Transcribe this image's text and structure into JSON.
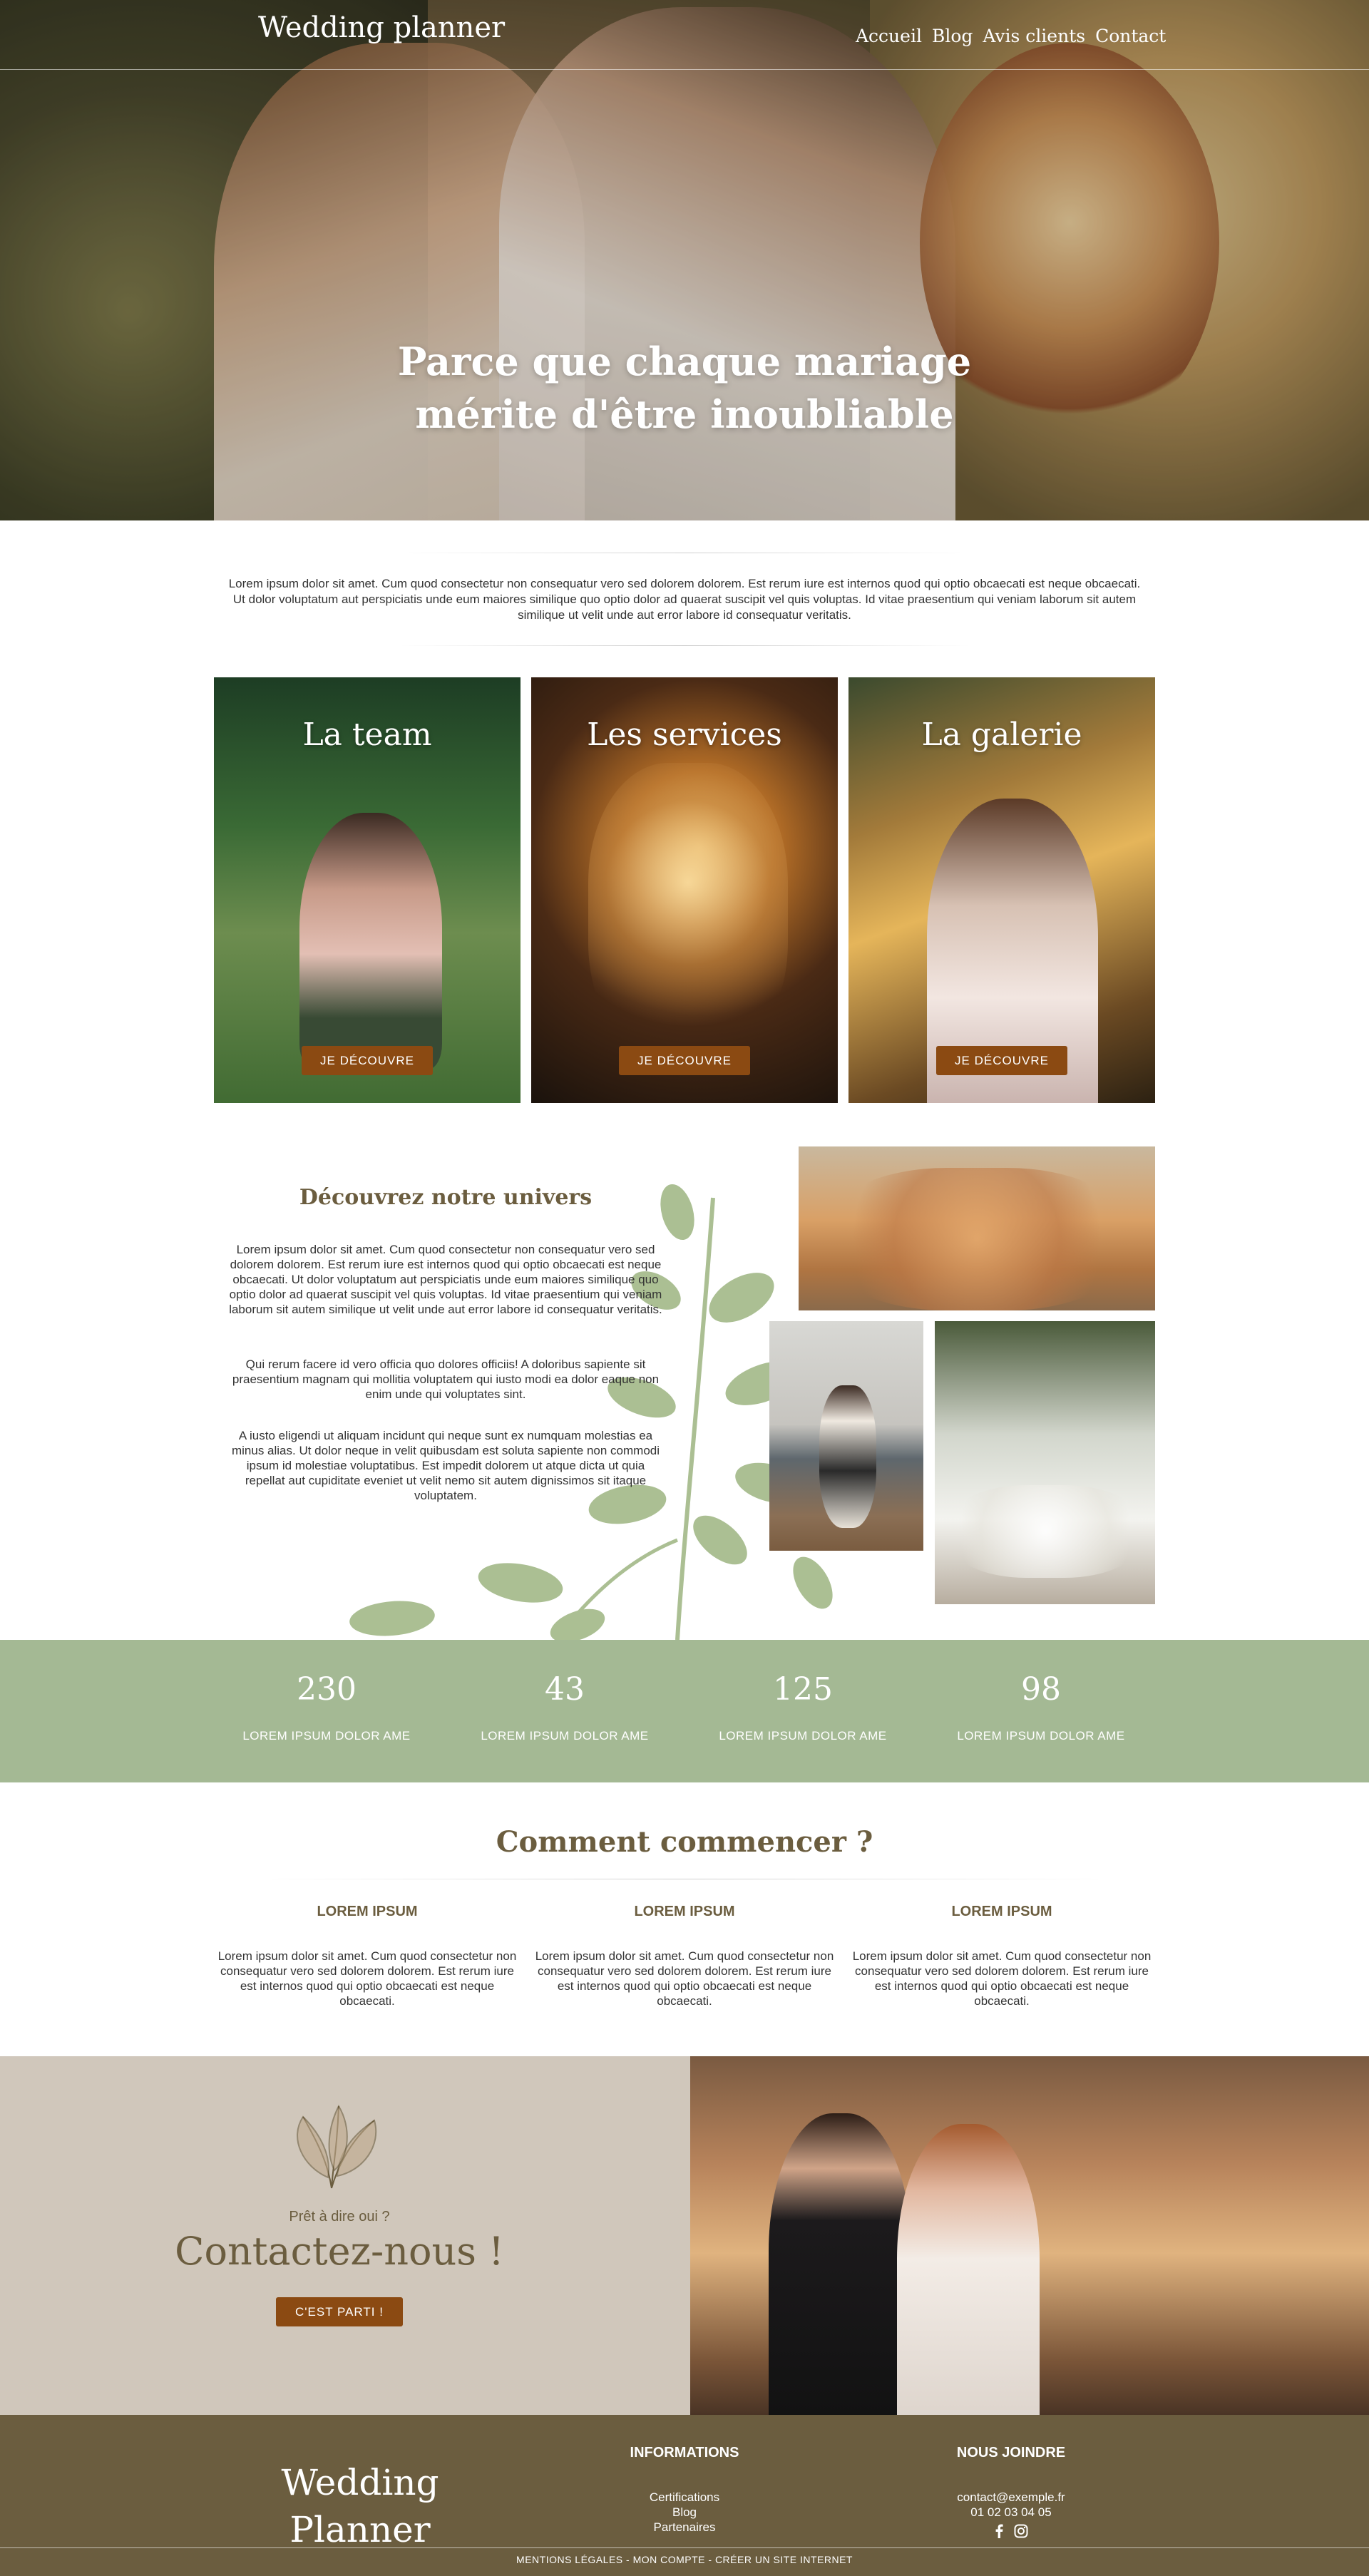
{
  "header": {
    "logo": "Wedding planner",
    "nav": [
      "Accueil",
      "Blog",
      "Avis clients",
      "Contact"
    ]
  },
  "hero": {
    "title": "Parce que chaque mariage mérite d'être inoubliable"
  },
  "intro": {
    "text": "Lorem ipsum dolor sit amet. Cum quod consectetur non consequatur vero sed dolorem dolorem. Est rerum iure est internos quod qui optio obcaecati est neque obcaecati. Ut dolor voluptatum aut perspiciatis unde eum maiores similique quo optio dolor ad quaerat suscipit vel quis voluptas. Id vitae praesentium qui veniam laborum sit autem similique ut velit unde aut error labore id consequatur veritatis."
  },
  "cards": [
    {
      "title": "La team",
      "button": "JE DÉCOUVRE"
    },
    {
      "title": "Les services",
      "button": "JE DÉCOUVRE"
    },
    {
      "title": "La galerie",
      "button": "JE DÉCOUVRE"
    }
  ],
  "univers": {
    "title": "Découvrez notre univers",
    "paragraphs": [
      "Lorem ipsum dolor sit amet. Cum quod consectetur non consequatur vero sed dolorem dolorem. Est rerum iure est internos quod qui optio obcaecati est neque obcaecati. Ut dolor voluptatum aut perspiciatis unde eum maiores similique quo optio dolor ad quaerat suscipit vel quis voluptas. Id vitae praesentium qui veniam laborum sit autem similique ut velit unde aut error labore id consequatur veritatis.",
      "Qui rerum facere id vero officia quo dolores officiis! A doloribus sapiente sit praesentium magnam qui mollitia voluptatem qui iusto modi ea dolor eaque non enim unde qui voluptates sint.",
      "A iusto eligendi ut aliquam incidunt qui neque sunt ex numquam molestias ea minus alias. Ut dolor neque in velit quibusdam est soluta sapiente non commodi ipsum id molestiae voluptatibus. Est impedit dolorem ut atque dicta ut quia repellat aut cupiditate eveniet ut velit nemo sit autem dignissimos sit itaque voluptatem."
    ]
  },
  "stats": [
    {
      "number": "230",
      "label": "LOREM IPSUM DOLOR AME"
    },
    {
      "number": "43",
      "label": "LOREM IPSUM DOLOR AME"
    },
    {
      "number": "125",
      "label": "LOREM IPSUM DOLOR AME"
    },
    {
      "number": "98",
      "label": "LOREM IPSUM DOLOR AME"
    }
  ],
  "start": {
    "title": "Comment commencer ?",
    "columns": [
      {
        "heading": "LOREM IPSUM",
        "text": "Lorem ipsum dolor sit amet. Cum quod consectetur non consequatur vero sed dolorem dolorem. Est rerum iure est internos quod qui optio obcaecati est neque obcaecati."
      },
      {
        "heading": "LOREM IPSUM",
        "text": "Lorem ipsum dolor sit amet. Cum quod consectetur non consequatur vero sed dolorem dolorem. Est rerum iure est internos quod qui optio obcaecati est neque obcaecati."
      },
      {
        "heading": "LOREM IPSUM",
        "text": "Lorem ipsum dolor sit amet. Cum quod consectetur non consequatur vero sed dolorem dolorem. Est rerum iure est internos quod qui optio obcaecati est neque obcaecati."
      }
    ]
  },
  "contact": {
    "small": "Prêt à dire oui ?",
    "title": "Contactez-nous !",
    "button": "C'EST PARTI !"
  },
  "footer": {
    "logo_line1": "Wedding",
    "logo_line2": "Planner",
    "info_title": "INFORMATIONS",
    "info_links": [
      "Certifications",
      "Blog",
      "Partenaires"
    ],
    "join_title": "NOUS JOINDRE",
    "email": "contact@exemple.fr",
    "phone": "01 02 03 04 05",
    "social_icons": [
      "facebook-icon",
      "instagram-icon"
    ],
    "bottom": "MENTIONS LÉGALES - MON COMPTE - CRÉER UN SITE INTERNET"
  },
  "colors": {
    "accent_button": "#8b4a12",
    "olive": "#6b5d3f",
    "sage": "#a4b994",
    "beige": "#d0c7bb"
  }
}
